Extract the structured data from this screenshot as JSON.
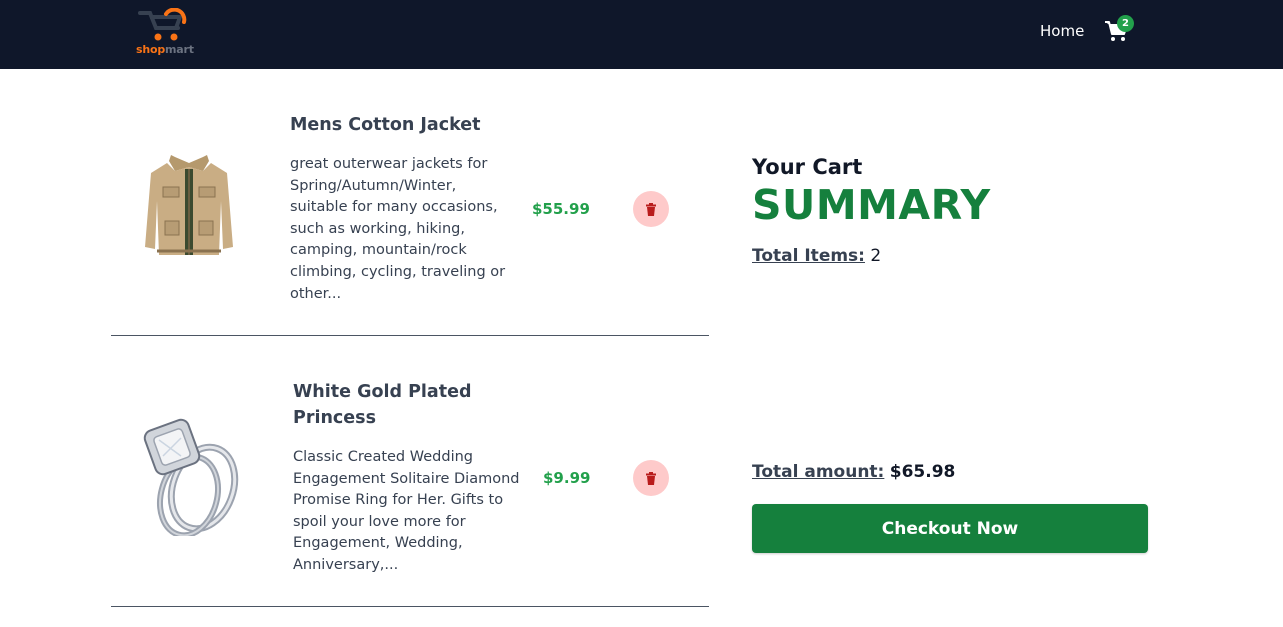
{
  "header": {
    "logo": {
      "shop": "shop",
      "mart": "mart"
    },
    "nav_home": "Home",
    "cart_count": "2",
    "colors": {
      "background": "#0f172a",
      "badge": "#22a04b",
      "logo_accent": "#f97316"
    }
  },
  "cart": {
    "items": [
      {
        "title": "Mens Cotton Jacket",
        "description": "great outerwear jackets for Spring/Autumn/Winter, suitable for many occasions, such as working, hiking, camping, mountain/rock climbing, cycling, traveling or other...",
        "price": "$55.99",
        "image_icon": "jacket-image",
        "delete_icon": "trash-icon"
      },
      {
        "title": "White Gold Plated Princess",
        "description": "Classic Created Wedding Engagement Solitaire Diamond Promise Ring for Her. Gifts to spoil your love more for Engagement, Wedding, Anniversary,...",
        "price": "$9.99",
        "image_icon": "ring-image",
        "delete_icon": "trash-icon"
      }
    ]
  },
  "summary": {
    "subtitle": "Your Cart",
    "title": "SUMMARY",
    "total_items_label": "Total Items:",
    "total_items_value": "2",
    "total_amount_label": "Total amount:",
    "total_amount_value": "$65.98",
    "checkout_label": "Checkout Now",
    "colors": {
      "accent": "#15803d",
      "price": "#22a04b",
      "delete_bg": "#fecaca",
      "delete_icon": "#b91c1c"
    }
  }
}
